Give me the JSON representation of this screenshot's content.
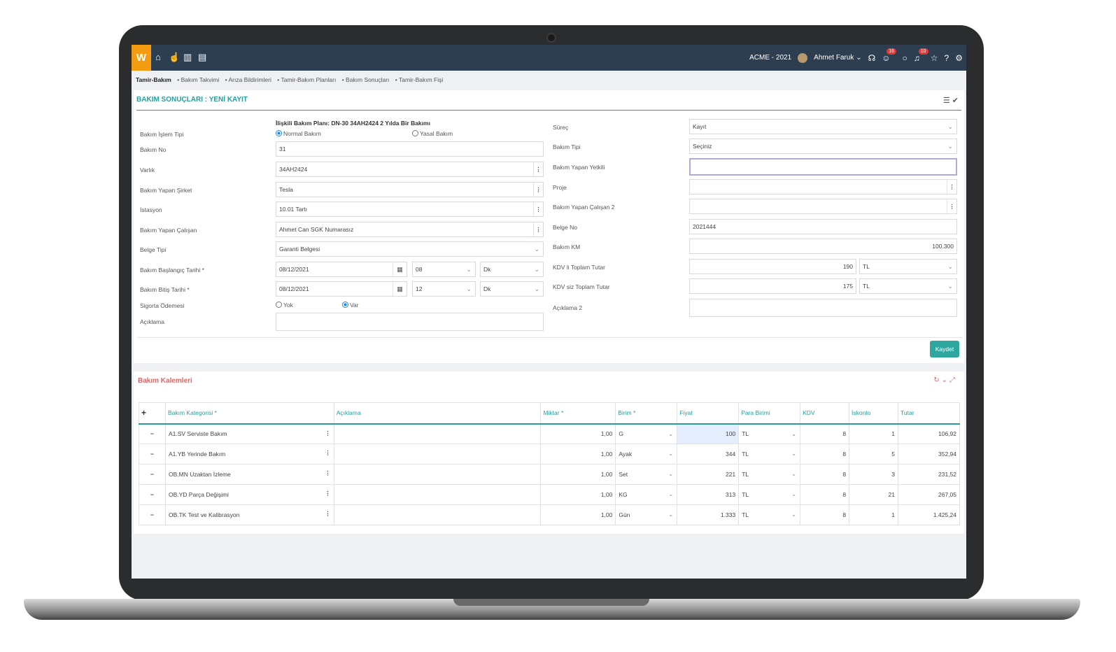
{
  "topbar": {
    "logo": "W",
    "company": "ACME - 2021",
    "user": "Ahmet Faruk",
    "badge_messages": "16",
    "badge_notifications": "10"
  },
  "breadcrumb": {
    "active": "Tamir-Bakım",
    "items": [
      "Bakım Takvimi",
      "Arıza Bildirimleri",
      "Tamir-Bakım Planları",
      "Bakım Sonuçları",
      "Tamir-Bakım Fişi"
    ]
  },
  "form": {
    "title": "BAKIM SONUÇLARI : YENİ KAYIT",
    "related_plan": "İlişkili Bakım Planı: DN-30 34AH2424 2 Yılda Bir Bakımı",
    "left": {
      "islem_tipi_label": "Bakım İşlem Tipi",
      "islem_opt1": "Normal Bakım",
      "islem_opt2": "Yasal Bakım",
      "bakim_no_label": "Bakım No",
      "bakim_no": "31",
      "varlik_label": "Varlık",
      "varlik": "34AH2424",
      "sirket_label": "Bakım Yapan Şirket",
      "sirket": "Tesla",
      "istasyon_label": "İstasyon",
      "istasyon": "10.01 Tartı",
      "calisan_label": "Bakım Yapan Çalışan",
      "calisan": "Ahmet Can SGK Numarasız",
      "belge_tipi_label": "Belge Tipi",
      "belge_tipi": "Garanti Belgesi",
      "baslangic_label": "Bakım Başlangıç Tarihi *",
      "baslangic_tarih": "08/12/2021",
      "baslangic_saat": "08",
      "baslangic_dk": "Dk",
      "bitis_label": "Bakım Bitiş Tarihi *",
      "bitis_tarih": "08/12/2021",
      "bitis_saat": "12",
      "bitis_dk": "Dk",
      "sigorta_label": "Sigorta Ödemesi",
      "sigorta_yok": "Yok",
      "sigorta_var": "Var",
      "aciklama_label": "Açıklama"
    },
    "right": {
      "surec_label": "Süreç",
      "surec": "Kayıt",
      "bakim_tipi_label": "Bakım Tipi",
      "bakim_tipi": "Seçiniz",
      "yetkili_label": "Bakım Yapan Yetkili",
      "proje_label": "Proje",
      "calisan2_label": "Bakım Yapan Çalışan 2",
      "belge_no_label": "Belge No",
      "belge_no": "2021444",
      "km_label": "Bakım KM",
      "km": "100.300",
      "kdvli_label": "KDV li Toplam Tutar",
      "kdvli": "190",
      "kdvli_cur": "TL",
      "kdvsiz_label": "KDV siz Toplam Tutar",
      "kdvsiz": "175",
      "kdvsiz_cur": "TL",
      "aciklama2_label": "Açıklama 2"
    },
    "save_label": "Kaydet"
  },
  "items": {
    "title": "Bakım Kalemleri",
    "headers": [
      "Bakım Kategorisi *",
      "Açıklama",
      "Miktar *",
      "Birim *",
      "Fiyat",
      "Para Birimi",
      "KDV",
      "İskonto",
      "Tutar"
    ],
    "rows": [
      {
        "kategori": "A1.SV Serviste Bakım",
        "miktar": "1,00",
        "birim": "G",
        "fiyat": "100",
        "para": "TL",
        "kdv": "8",
        "iskonto": "1",
        "tutar": "106,92"
      },
      {
        "kategori": "A1.YB Yerinde Bakım",
        "miktar": "1,00",
        "birim": "Ayak",
        "fiyat": "344",
        "para": "TL",
        "kdv": "8",
        "iskonto": "5",
        "tutar": "352,94"
      },
      {
        "kategori": "OB.MN Uzaktan İzleme",
        "miktar": "1,00",
        "birim": "Set",
        "fiyat": "221",
        "para": "TL",
        "kdv": "8",
        "iskonto": "3",
        "tutar": "231,52"
      },
      {
        "kategori": "OB.YD Parça Değişimi",
        "miktar": "1,00",
        "birim": "KG",
        "fiyat": "313",
        "para": "TL",
        "kdv": "8",
        "iskonto": "21",
        "tutar": "267,05"
      },
      {
        "kategori": "OB.TK Test ve Kalibrasyon",
        "miktar": "1,00",
        "birim": "Gün",
        "fiyat": "1.333",
        "para": "TL",
        "kdv": "8",
        "iskonto": "1",
        "tutar": "1.425,24"
      }
    ]
  }
}
